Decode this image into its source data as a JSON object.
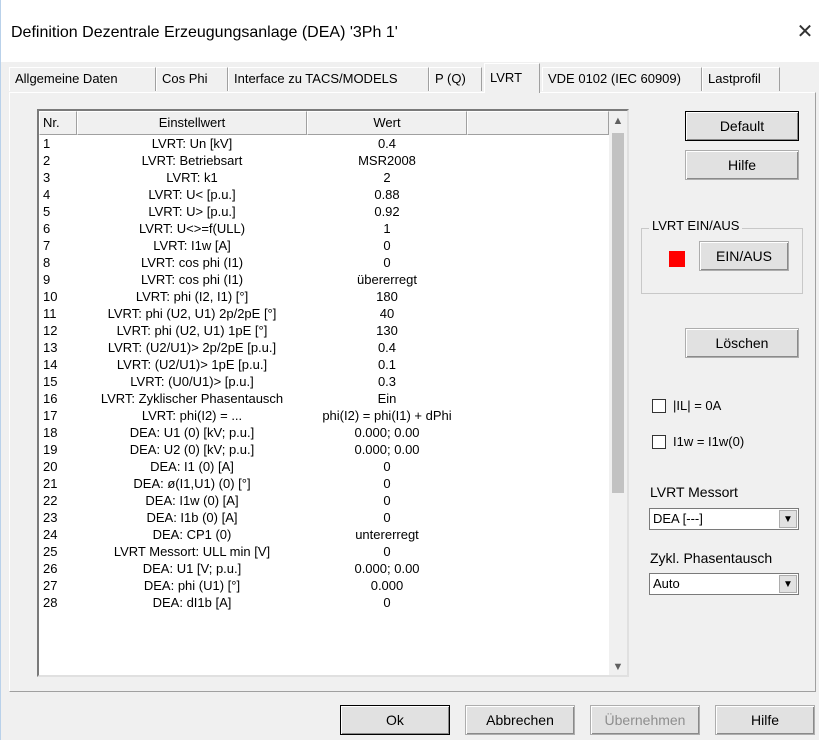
{
  "window": {
    "title": "Definition Dezentrale Erzeugungsanlage (DEA) '3Ph 1'",
    "close_glyph": "✕"
  },
  "tabs": [
    {
      "label": "Allgemeine Daten"
    },
    {
      "label": "Cos Phi"
    },
    {
      "label": "Interface zu TACS/MODELS"
    },
    {
      "label": "P (Q)"
    },
    {
      "label": "LVRT"
    },
    {
      "label": "VDE 0102 (IEC 60909)"
    },
    {
      "label": "Lastprofil"
    }
  ],
  "active_tab": "LVRT",
  "grid": {
    "columns": [
      "Nr.",
      "Einstellwert",
      "Wert",
      ""
    ],
    "rows": [
      {
        "nr": "1",
        "name": "LVRT: Un [kV]",
        "value": "0.4"
      },
      {
        "nr": "2",
        "name": "LVRT: Betriebsart",
        "value": "MSR2008"
      },
      {
        "nr": "3",
        "name": "LVRT: k1",
        "value": "2"
      },
      {
        "nr": "4",
        "name": "LVRT: U< [p.u.]",
        "value": "0.88"
      },
      {
        "nr": "5",
        "name": "LVRT: U> [p.u.]",
        "value": "0.92"
      },
      {
        "nr": "6",
        "name": "LVRT: U<>=f(ULL)",
        "value": "1"
      },
      {
        "nr": "7",
        "name": "LVRT: I1w [A]",
        "value": "0"
      },
      {
        "nr": "8",
        "name": "LVRT: cos phi (I1)",
        "value": "0"
      },
      {
        "nr": "9",
        "name": "LVRT: cos phi (I1)",
        "value": "übererregt"
      },
      {
        "nr": "10",
        "name": "LVRT: phi (I2, I1) [°]",
        "value": "180"
      },
      {
        "nr": "11",
        "name": "LVRT: phi (U2, U1) 2p/2pE [°]",
        "value": "40"
      },
      {
        "nr": "12",
        "name": "LVRT: phi (U2, U1) 1pE [°]",
        "value": "130"
      },
      {
        "nr": "13",
        "name": "LVRT: (U2/U1)> 2p/2pE [p.u.]",
        "value": "0.4"
      },
      {
        "nr": "14",
        "name": "LVRT: (U2/U1)> 1pE [p.u.]",
        "value": "0.1"
      },
      {
        "nr": "15",
        "name": "LVRT: (U0/U1)> [p.u.]",
        "value": "0.3"
      },
      {
        "nr": "16",
        "name": "LVRT: Zyklischer Phasentausch",
        "value": "Ein"
      },
      {
        "nr": "17",
        "name": "LVRT: phi(I2) = ...",
        "value": "phi(I2) = phi(I1) + dPhi"
      },
      {
        "nr": "18",
        "name": "DEA: U1 (0) [kV; p.u.]",
        "value": "0.000; 0.00"
      },
      {
        "nr": "19",
        "name": "DEA: U2 (0) [kV; p.u.]",
        "value": "0.000; 0.00"
      },
      {
        "nr": "20",
        "name": "DEA: I1 (0) [A]",
        "value": "0"
      },
      {
        "nr": "21",
        "name": "DEA: ø(I1,U1) (0) [°]",
        "value": "0"
      },
      {
        "nr": "22",
        "name": "DEA: I1w (0) [A]",
        "value": "0"
      },
      {
        "nr": "23",
        "name": "DEA: I1b (0) [A]",
        "value": "0"
      },
      {
        "nr": "24",
        "name": "DEA: CP1 (0)",
        "value": "untererregt"
      },
      {
        "nr": "25",
        "name": "LVRT Messort: ULL min [V]",
        "value": "0"
      },
      {
        "nr": "26",
        "name": "DEA: U1 [V; p.u.]",
        "value": "0.000; 0.00"
      },
      {
        "nr": "27",
        "name": "DEA: phi (U1) [°]",
        "value": "0.000"
      },
      {
        "nr": "28",
        "name": "DEA: dI1b [A]",
        "value": "0"
      }
    ]
  },
  "right_panel": {
    "default_label": "Default",
    "help_label": "Hilfe",
    "lvrt_group_label": "LVRT EIN/AUS",
    "toggle_label": "EIN/AUS",
    "indicator_color": "#ff0000",
    "delete_label": "Löschen",
    "check_il_label": "|IL| = 0A",
    "check_i1w_label": "I1w = I1w(0)",
    "messort_label": "LVRT Messort",
    "messort_value": "DEA [---]",
    "phasentausch_label": "Zykl. Phasentausch",
    "phasentausch_value": "Auto"
  },
  "footer": {
    "ok_label": "Ok",
    "cancel_label": "Abbrechen",
    "apply_label": "Übernehmen",
    "help_label": "Hilfe"
  },
  "icons": {
    "scroll_up": "▲",
    "scroll_down": "▼",
    "dropdown": "▼"
  }
}
